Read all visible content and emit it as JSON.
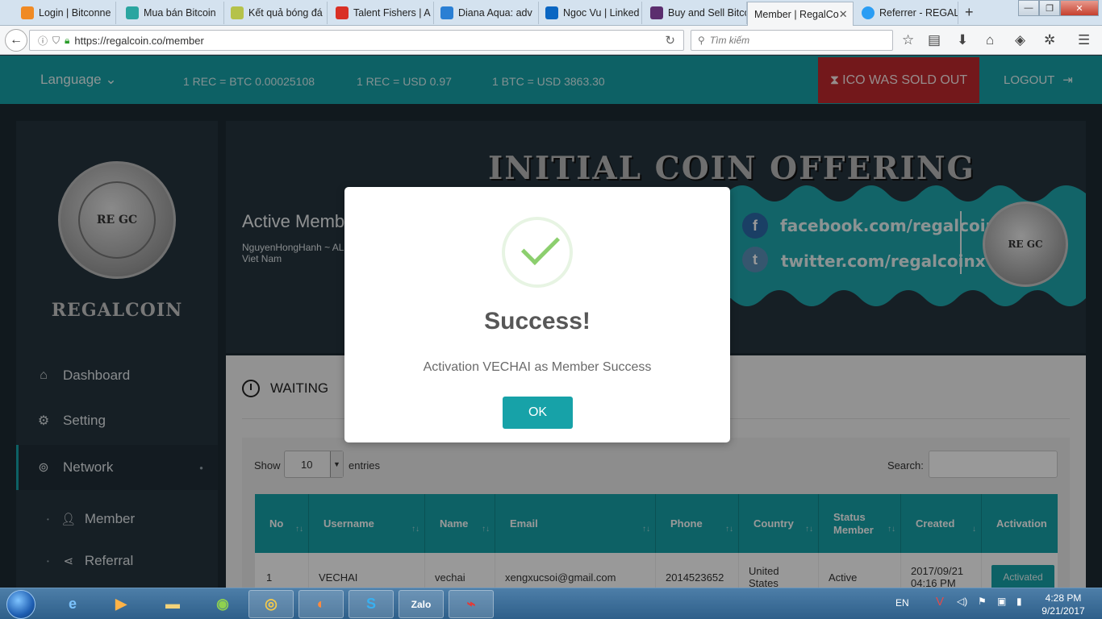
{
  "browser": {
    "tabs": [
      {
        "label": "Login | Bitconne",
        "color": "#f08a24"
      },
      {
        "label": "Mua bán Bitcoin",
        "color": "#2aa5a0"
      },
      {
        "label": "Kết quả bóng đá",
        "color": "#b5c24a"
      },
      {
        "label": "Talent Fishers | A",
        "color": "#d93025"
      },
      {
        "label": "Diana Aqua: adv",
        "color": "#2a7fd4"
      },
      {
        "label": "Ngoc Vu | Linked",
        "color": "#0a66c2"
      },
      {
        "label": "Buy and Sell Bitco",
        "color": "#5b2d6e"
      },
      {
        "label": "Member | RegalCo",
        "color": "#ffffff"
      },
      {
        "label": "Referrer - REGAL",
        "color": "#2a9df4"
      }
    ],
    "url": "https://regalcoin.co/member",
    "search_placeholder": "Tìm kiếm"
  },
  "header": {
    "language": "Language",
    "rates": [
      "1 REC = BTC 0.00025108",
      "1 REC = USD 0.97",
      "1 BTC = USD 3863.30"
    ],
    "ico_status": "ICO WAS SOLD OUT",
    "logout": "LOGOUT"
  },
  "sidebar": {
    "brand": "REGALCOIN",
    "logo_text": "RE GC",
    "items": [
      {
        "label": "Dashboard",
        "icon": "home-icon"
      },
      {
        "label": "Setting",
        "icon": "gears-icon"
      },
      {
        "label": "Network",
        "icon": "podcast-icon"
      }
    ],
    "subitems": [
      {
        "label": "Member",
        "icon": "user-icon"
      },
      {
        "label": "Referral",
        "icon": "share-icon"
      }
    ]
  },
  "banner": {
    "title": "Active Memb",
    "user_line1": "NguyenHongHanh ~ AL",
    "user_line2": "Viet Nam",
    "ico_title": "INITIAL COIN OFFERING",
    "facebook": "facebook.com/regalcoin",
    "twitter": "twitter.com/regalcoinx"
  },
  "content": {
    "section_title": "WAITING",
    "show_label": "Show",
    "entries_value": "10",
    "entries_label": "entries",
    "search_label": "Search:",
    "columns": [
      "No",
      "Username",
      "Name",
      "Email",
      "Phone",
      "Country",
      "Status Member",
      "Created",
      "Activation"
    ],
    "rows": [
      {
        "no": "1",
        "username": "VECHAI",
        "name": "vechai",
        "email": "xengxucsoi@gmail.com",
        "phone": "2014523652",
        "country": "United States",
        "status": "Active",
        "created": "2017/09/21 04:16 PM",
        "activation": "Activated"
      }
    ]
  },
  "modal": {
    "title": "Success!",
    "message": "Activation VECHAI as Member Success",
    "ok": "OK"
  },
  "taskbar": {
    "lang": "EN",
    "time": "4:28 PM",
    "date": "9/21/2017"
  },
  "colors": {
    "accent": "#17a2a8",
    "danger": "#c0282d",
    "success": "#8ccf6e"
  }
}
